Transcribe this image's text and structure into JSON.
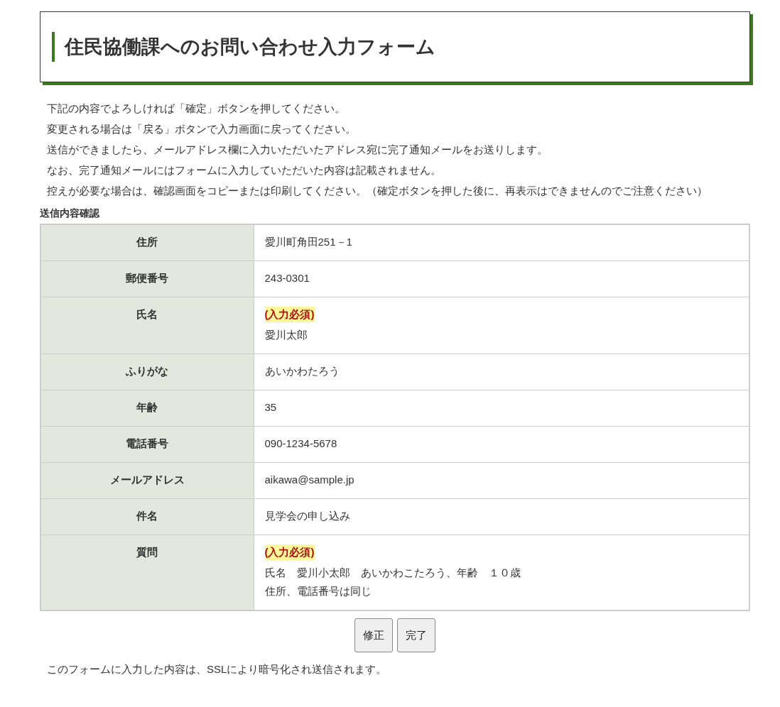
{
  "title": "住民協働課へのお問い合わせ入力フォーム",
  "intro": [
    "下記の内容でよろしければ「確定」ボタンを押してください。",
    "変更される場合は「戻る」ボタンで入力画面に戻ってください。",
    "送信ができましたら、メールアドレス欄に入力いただいたアドレス宛に完了通知メールをお送りします。",
    "なお、完了通知メールにはフォームに入力していただいた内容は記載されません。",
    "控えが必要な場合は、確認画面をコピーまたは印刷してください。（確定ボタンを押した後に、再表示はできませんのでご注意ください）"
  ],
  "section_title": "送信内容確認",
  "rows": [
    {
      "label": "住所",
      "values": [
        "愛川町角田251－1"
      ]
    },
    {
      "label": "郵便番号",
      "values": [
        "243-0301"
      ]
    },
    {
      "label": "氏名",
      "badge": "(入力必須)",
      "values": [
        "愛川太郎"
      ]
    },
    {
      "label": "ふりがな",
      "values": [
        "あいかわたろう"
      ]
    },
    {
      "label": "年齢",
      "values": [
        "35"
      ]
    },
    {
      "label": "電話番号",
      "values": [
        "090-1234-5678"
      ]
    },
    {
      "label": "メールアドレス",
      "values": [
        "aikawa@sample.jp"
      ]
    },
    {
      "label": "件名",
      "values": [
        "見学会の申し込み"
      ]
    },
    {
      "label": "質問",
      "badge": "(入力必須)",
      "values": [
        "氏名　愛川小太郎　あいかわこたろう、年齢　１０歳",
        "住所、電話番号は同じ"
      ]
    }
  ],
  "buttons": [
    "修正",
    "完了"
  ],
  "footer": "このフォームに入力した内容は、SSLにより暗号化され送信されます。"
}
